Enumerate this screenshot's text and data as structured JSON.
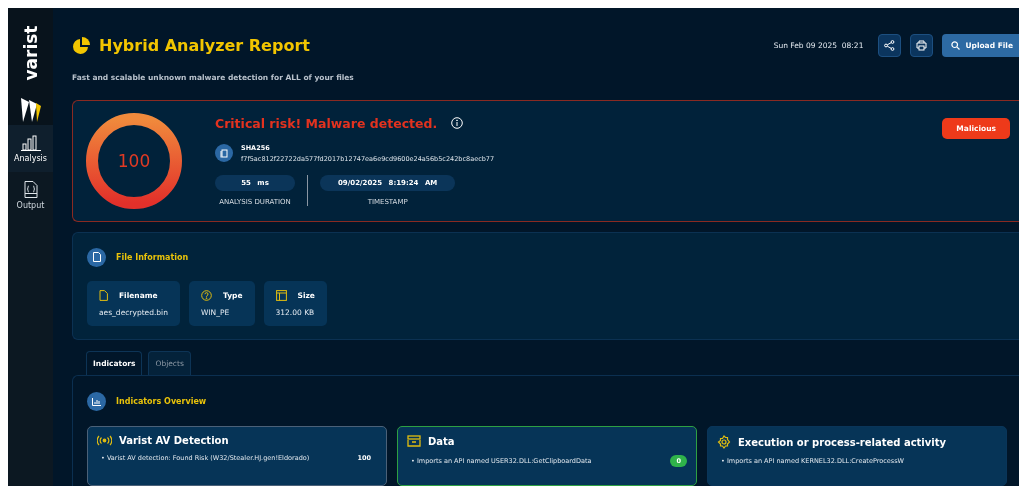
{
  "sidebar": {
    "logo": "varist",
    "items": [
      {
        "label": "Analysis",
        "kind": "chart",
        "selected": true
      },
      {
        "label": "Output",
        "kind": "json",
        "selected": false
      }
    ]
  },
  "header": {
    "title": "Hybrid Analyzer Report",
    "subtitle": "Fast and scalable unknown malware detection for ALL of your files",
    "date": "Sun Feb 09 2025",
    "time": "08:21",
    "upload_button": "Upload File"
  },
  "risk": {
    "score": "100",
    "level": 1,
    "headline": "Critical risk! Malware detected.",
    "hash_label": "SHA256",
    "hash": "f7f5ac812f22722da577fd2017b12747ea6e9cd9600e24a56b5c242bc8aecb77",
    "duration": {
      "value": "55 ms",
      "label": "ANALYSIS DURATION"
    },
    "timestamp": {
      "date": "09/02/2025",
      "time": "8:19:24 AM",
      "label": "TIMESTAMP"
    },
    "verdict": "Malicious"
  },
  "file_info": {
    "title": "File Information",
    "fields": [
      {
        "kind": "file",
        "label": "Filename",
        "value": "aes_decrypted.bin"
      },
      {
        "kind": "type",
        "label": "Type",
        "value": "WIN_PE"
      },
      {
        "kind": "size",
        "label": "Size",
        "value": "312.00 KB"
      }
    ]
  },
  "tabs": [
    {
      "label": "Indicators",
      "selected": true
    },
    {
      "label": "Objects",
      "selected": false
    }
  ],
  "indicators": {
    "title": "Indicators Overview",
    "groups": [
      {
        "kind": "antenna",
        "title": "Varist AV Detection",
        "color": "#4b6178",
        "items": [
          {
            "text": "• Varist AV detection: Found Risk (W32/Stealer.HJ.gen!Eldorado)",
            "count": "100",
            "kind": "plain"
          }
        ]
      },
      {
        "kind": "tray",
        "title": "Data",
        "color": "#2ea043",
        "items": [
          {
            "text": "• Imports an API named USER32.DLL:GetClipboardData",
            "count": "0",
            "kind": "pill"
          }
        ]
      },
      {
        "kind": "gear",
        "title": "Execution or process-related activity",
        "color": "#0a3559",
        "items": [
          {
            "text": "• Imports an API named KERNEL32.DLL:CreateProcessW"
          }
        ]
      }
    ]
  }
}
